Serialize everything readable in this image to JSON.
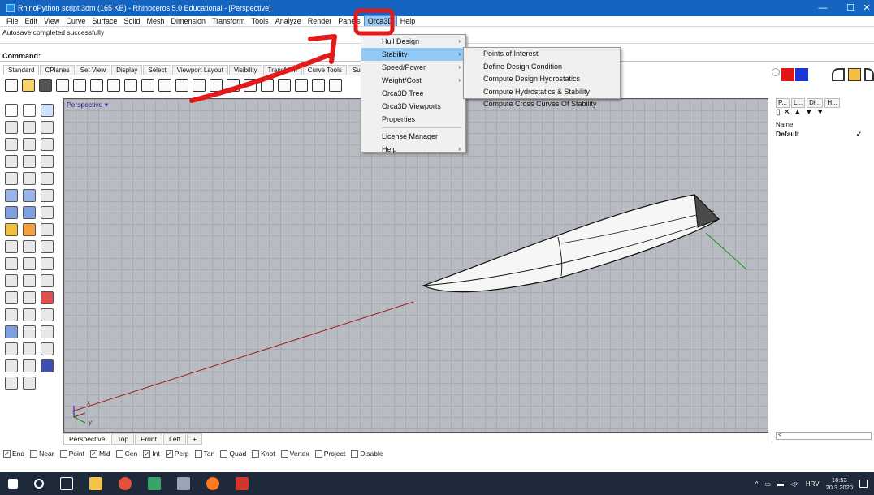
{
  "window": {
    "title": "RhinoPython script.3dm (165 KB) - Rhinoceros 5.0 Educational - [Perspective]",
    "controls": {
      "minimize": "—",
      "maximize": "☐",
      "close": "✕"
    }
  },
  "menubar": {
    "items": [
      "File",
      "Edit",
      "View",
      "Curve",
      "Surface",
      "Solid",
      "Mesh",
      "Dimension",
      "Transform",
      "Tools",
      "Analyze",
      "Render",
      "Panels",
      "Orca3D",
      "Help"
    ],
    "active": "Orca3D"
  },
  "status": {
    "message": "Autosave completed successfully"
  },
  "command": {
    "label": "Command:"
  },
  "toolbar_tabs": [
    "Standard",
    "CPlanes",
    "Set View",
    "Display",
    "Select",
    "Viewport Layout",
    "Visibility",
    "Transform",
    "Curve Tools",
    "Surface"
  ],
  "viewport": {
    "label": "Perspective",
    "axis_x": "x",
    "axis_y": "y",
    "tabs": [
      "Perspective",
      "Top",
      "Front",
      "Left"
    ]
  },
  "osnap": {
    "items": [
      {
        "label": "End",
        "checked": true
      },
      {
        "label": "Near",
        "checked": false
      },
      {
        "label": "Point",
        "checked": false
      },
      {
        "label": "Mid",
        "checked": true
      },
      {
        "label": "Cen",
        "checked": false
      },
      {
        "label": "Int",
        "checked": true
      },
      {
        "label": "Perp",
        "checked": true
      },
      {
        "label": "Tan",
        "checked": false
      },
      {
        "label": "Quad",
        "checked": false
      },
      {
        "label": "Knot",
        "checked": false
      },
      {
        "label": "Vertex",
        "checked": false
      },
      {
        "label": "Project",
        "checked": false
      },
      {
        "label": "Disable",
        "checked": false
      }
    ]
  },
  "orca_menu": {
    "items": [
      {
        "label": "Hull Design",
        "has_submenu": true
      },
      {
        "label": "Stability",
        "has_submenu": true,
        "selected": true
      },
      {
        "label": "Speed/Power",
        "has_submenu": true
      },
      {
        "label": "Weight/Cost",
        "has_submenu": true
      },
      {
        "label": "Orca3D Tree",
        "has_submenu": false
      },
      {
        "label": "Orca3D Viewports",
        "has_submenu": false
      },
      {
        "label": "Properties",
        "has_submenu": false
      },
      {
        "label": "License Manager",
        "has_submenu": false
      },
      {
        "label": "Help",
        "has_submenu": true
      }
    ]
  },
  "stability_submenu": {
    "items": [
      "Points of Interest",
      "Define Design Condition",
      "Compute Design Hydrostatics",
      "Compute Hydrostatics & Stability",
      "Compute Cross Curves Of Stability"
    ]
  },
  "right_panel": {
    "tabs": [
      "P...",
      "L...",
      "Di...",
      "H..."
    ],
    "column_name": "Name",
    "layer_default": "Default",
    "check": "✓",
    "scroll_left": "<"
  },
  "taskbar": {
    "lang": "HRV",
    "time": "16:53",
    "date": "20.3.2020"
  },
  "colors": {
    "titlebar": "#1565c0",
    "menu_highlight": "#91c9f7",
    "annotation": "#e11a1a"
  }
}
